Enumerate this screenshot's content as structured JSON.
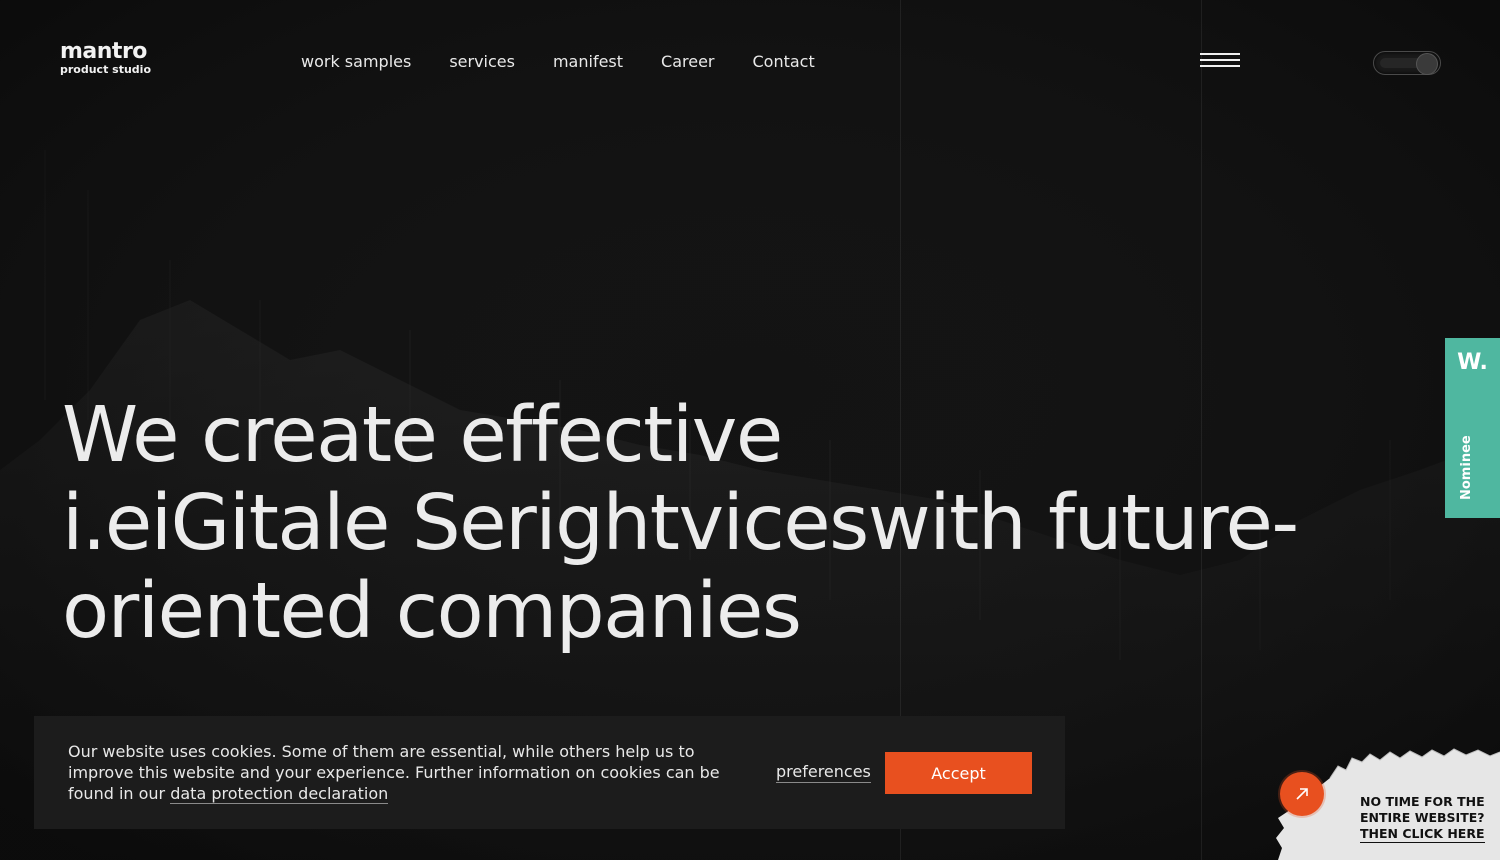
{
  "logo": {
    "name": "mantro",
    "tagline": "product studio"
  },
  "nav": [
    {
      "label": "work samples"
    },
    {
      "label": "services"
    },
    {
      "label": "manifest"
    },
    {
      "label": "Career"
    },
    {
      "label": "Contact"
    }
  ],
  "header": {
    "menu_icon": "hamburger-menu-icon",
    "theme_toggle": "dark-mode-toggle"
  },
  "hero": {
    "lines": [
      "We create effective",
      "i.eiGitale Serightviceswith future-",
      "oriented companies"
    ]
  },
  "award_badge": {
    "logo": "W.",
    "label": "Nominee",
    "color": "#4fb7a0"
  },
  "cookie_banner": {
    "text": "Our website uses cookies. Some of them are essential, while others help us to improve this website and your experience. Further information on cookies can be found in our",
    "link_label": "data protection declaration",
    "preferences_label": "preferences",
    "accept_label": "Accept",
    "accent_color": "#e8501f"
  },
  "shortcut": {
    "lines": [
      "NO TIME FOR THE",
      "ENTIRE WEBSITE?",
      "THEN CLICK HERE"
    ],
    "icon": "arrow-up-right-icon"
  }
}
